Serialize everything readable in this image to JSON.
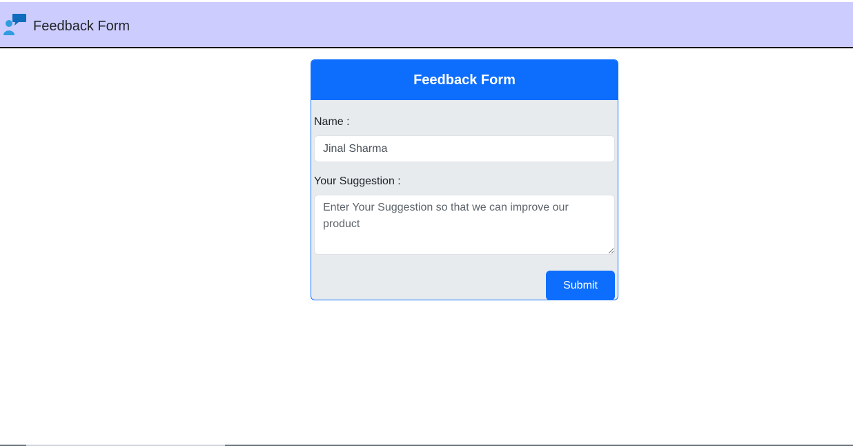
{
  "navbar": {
    "brand_icon": "feedback-chat-icon",
    "title": "Feedback Form",
    "background": "#ccccff"
  },
  "card": {
    "header_title": "Feedback Form",
    "accent": "#0d6efd",
    "body_background": "#e8ebee",
    "name_label": "Name :",
    "name_value": "Jinal Sharma",
    "suggestion_label": "Your Suggestion :",
    "suggestion_placeholder": "Enter Your Suggestion so that we can improve our product",
    "submit_label": "Submit"
  }
}
